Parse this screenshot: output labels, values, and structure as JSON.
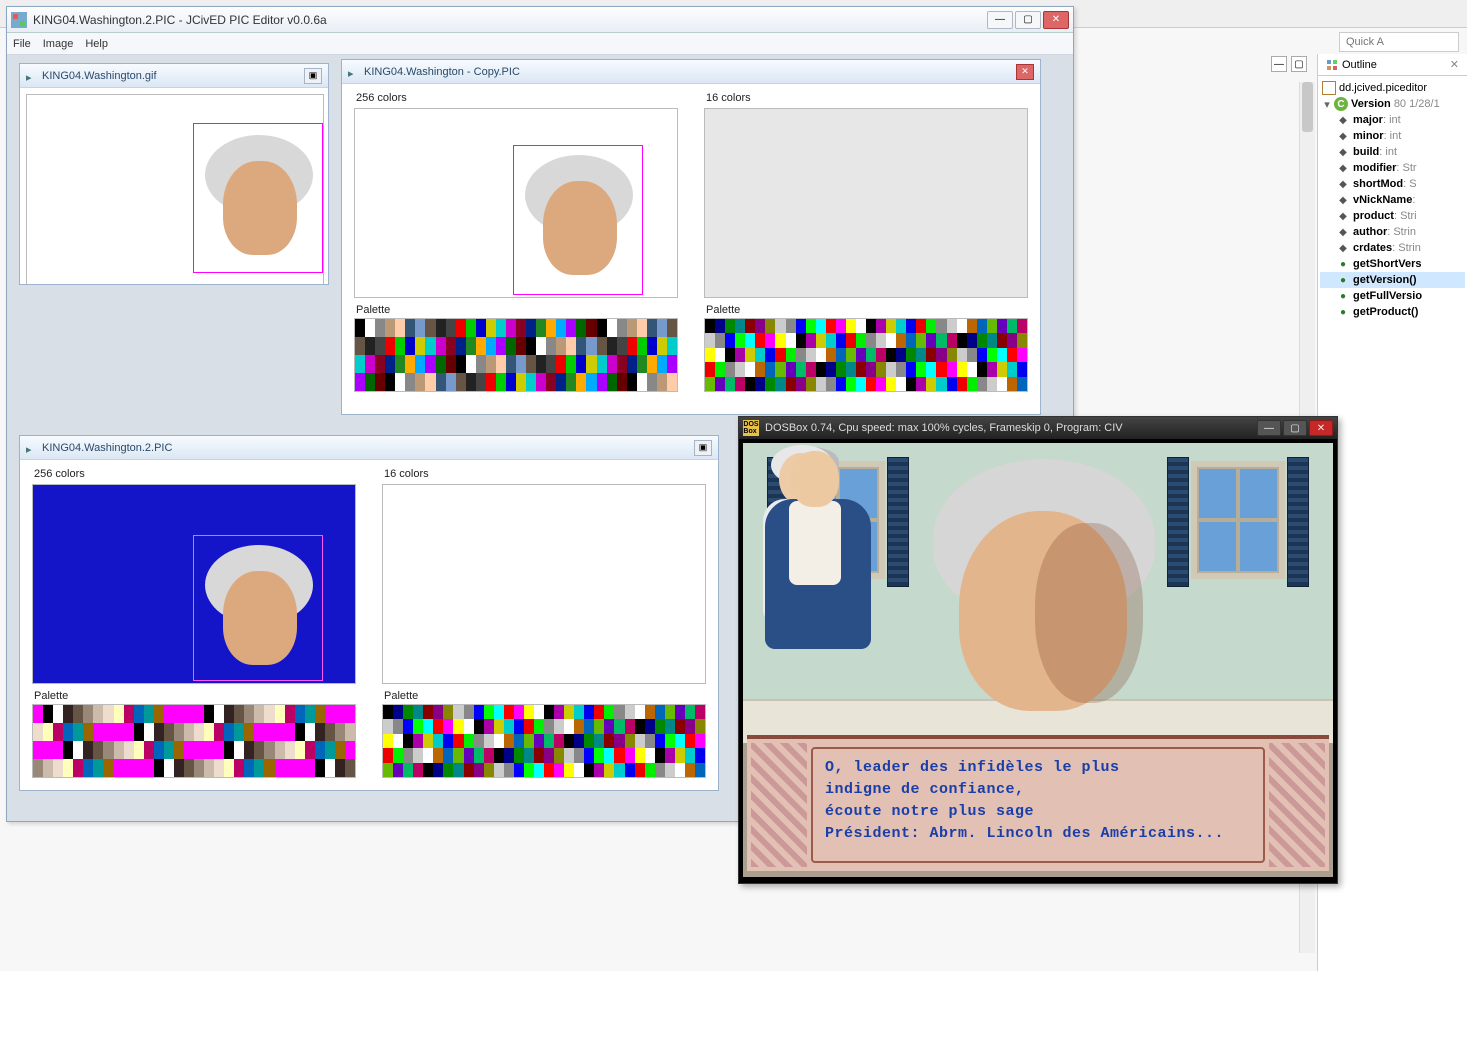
{
  "background": {
    "search_placeholder": "Quick A",
    "outline": {
      "tab_label": "Outline",
      "close_glyph": "✕",
      "nodes": {
        "pkg": "dd.jcived.piceditor",
        "cls": "Version",
        "cls_meta": "80  1/28/1",
        "major": {
          "n": "major",
          "t": ": int"
        },
        "minor": {
          "n": "minor",
          "t": ": int"
        },
        "build": {
          "n": "build",
          "t": ": int"
        },
        "modifier": {
          "n": "modifier",
          "t": ": Str"
        },
        "shortMod": {
          "n": "shortMod",
          "t": ": S"
        },
        "vNickName": {
          "n": "vNickName",
          "t": ":"
        },
        "product": {
          "n": "product",
          "t": ": Stri"
        },
        "author": {
          "n": "author",
          "t": ": Strin"
        },
        "crdates": {
          "n": "crdates",
          "t": ": Strin"
        },
        "getShortVers": {
          "n": "getShortVers",
          "t": ""
        },
        "getVersion": {
          "n": "getVersion()",
          "t": ""
        },
        "getFullVersio": {
          "n": "getFullVersio",
          "t": ""
        },
        "getProduct": {
          "n": "getProduct()",
          "t": ""
        }
      }
    }
  },
  "main_window": {
    "title": "KING04.Washington.2.PIC - JCivED PIC Editor v0.0.6a",
    "menu": {
      "file": "File",
      "image": "Image",
      "help": "Help"
    },
    "sub_gif": {
      "title": "KING04.Washington.gif"
    },
    "sub_copy": {
      "title": "KING04.Washington - Copy.PIC",
      "hdr256": "256 colors",
      "hdr16": "16 colors",
      "palette_label": "Palette"
    },
    "sub_pic2": {
      "title": "KING04.Washington.2.PIC",
      "hdr256": "256 colors",
      "hdr16": "16 colors",
      "palette_label": "Palette"
    }
  },
  "dosbox": {
    "title": "DOSBox 0.74, Cpu speed: max 100% cycles, Frameskip  0, Program:      CIV",
    "icon_text": "DOS\nBox",
    "dialog": {
      "l1": "O, leader des infidèles le plus",
      "l2": "indigne de confiance,",
      "l3": "écoute notre plus sage",
      "l4": "Président: Abrm. Lincoln des Américains..."
    }
  },
  "glyphs": {
    "min": "—",
    "max": "▢",
    "close": "✕",
    "pin": "▸"
  },
  "palettes": {
    "p256a": [
      "#000",
      "#fff",
      "#888",
      "#b97",
      "#fca",
      "#357",
      "#79c",
      "#654",
      "#222",
      "#444",
      "#e00",
      "#0c0",
      "#00c",
      "#cc0",
      "#0cc",
      "#c0c",
      "#802",
      "#028",
      "#282",
      "#fa0",
      "#0af",
      "#a0f",
      "#060",
      "#600"
    ],
    "p256b": [
      "#000",
      "#a0a",
      "#cc0",
      "#0cc",
      "#00e",
      "#e00",
      "#0e0",
      "#888",
      "#ccc",
      "#fff",
      "#b60",
      "#06b",
      "#6b0",
      "#60b",
      "#0b6",
      "#b06"
    ],
    "p16": [
      "#000",
      "#008",
      "#080",
      "#088",
      "#800",
      "#808",
      "#880",
      "#ccc",
      "#888",
      "#00f",
      "#0f0",
      "#0ff",
      "#f00",
      "#f0f",
      "#ff0",
      "#fff"
    ],
    "mag256": [
      "#f0f",
      "#000",
      "#fff",
      "#322",
      "#654",
      "#987",
      "#cba",
      "#edc",
      "#ffb",
      "#b06",
      "#06b",
      "#099",
      "#960",
      "#f0f",
      "#f0f",
      "#f0f"
    ]
  }
}
